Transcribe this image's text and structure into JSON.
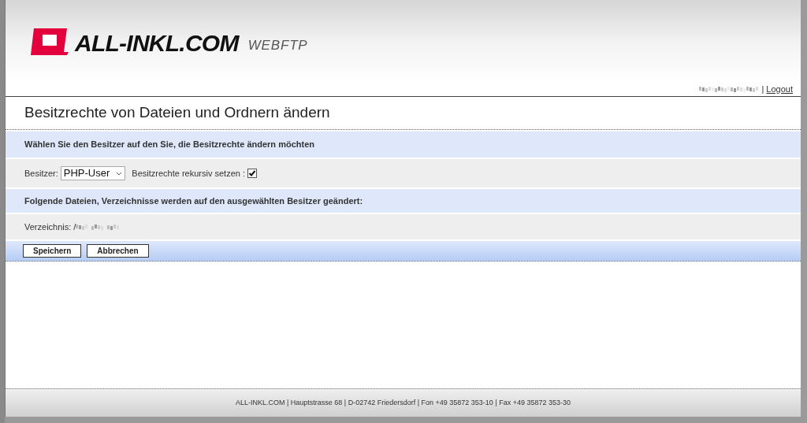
{
  "header": {
    "logo": "ALL-INKL.COM",
    "product": "WEBFTP",
    "separator": "|",
    "logout": "Logout"
  },
  "page_title": "Besitzrechte von Dateien und Ordnern ändern",
  "section_1": {
    "heading": "Wählen Sie den Besitzer auf den Sie, die Besitzrechte ändern möchten",
    "owner_label": "Besitzer:",
    "owner_value": "PHP-User",
    "recursive_label": "Besitzrechte rekursiv setzen :",
    "recursive_checked": true
  },
  "section_2": {
    "heading": "Folgende Dateien, Verzeichnisse werden auf den ausgewählten Besitzer geändert:",
    "directory_label": "Verzeichnis: /"
  },
  "buttons": [
    "Speichern",
    "Abbrechen"
  ],
  "footer": "ALL-INKL.COM | Hauptstrasse 68 | D-02742 Friedersdorf | Fon +49 35872 353-10 | Fax +49 35872 353-30"
}
